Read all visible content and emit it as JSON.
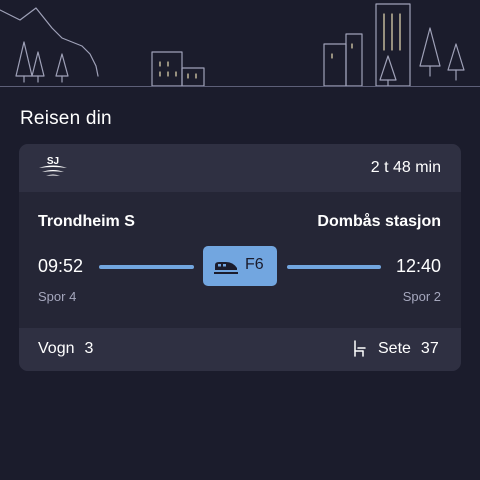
{
  "section_title": "Reisen din",
  "journey": {
    "operator_icon": "sj-logo-icon",
    "duration": "2 t 48 min",
    "from": {
      "station": "Trondheim S",
      "time": "09:52",
      "track": "Spor 4"
    },
    "to": {
      "station": "Dombås stasjon",
      "time": "12:40",
      "track": "Spor 2"
    },
    "line": {
      "icon": "train-icon",
      "code": "F6"
    },
    "car": {
      "label": "Vogn",
      "value": "3"
    },
    "seat": {
      "icon": "seat-icon",
      "label": "Sete",
      "value": "37"
    }
  },
  "colors": {
    "background": "#1b1c2c",
    "card": "#2c2d3e",
    "accent": "#72a6e0",
    "muted_text": "#a5a7bd"
  }
}
